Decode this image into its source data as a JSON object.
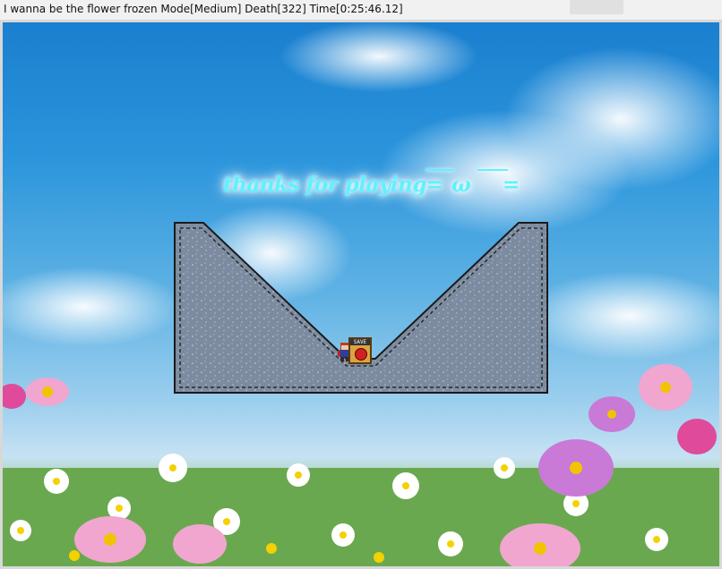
{
  "window": {
    "title": "I wanna be the flower frozen Mode[Medium] Death[322] Time[0:25:46.12]"
  },
  "game": {
    "message_main": "thanks for playing=",
    "message_face": "ω",
    "message_end": "=",
    "save_box_label": "SAVE"
  },
  "colors": {
    "sky_top": "#1a7fcf",
    "sky_bottom": "#c6e2f3",
    "text_glow": "#5ef2ff",
    "stone": "#7f8ea3",
    "stone_border": "#1a1a1a"
  }
}
